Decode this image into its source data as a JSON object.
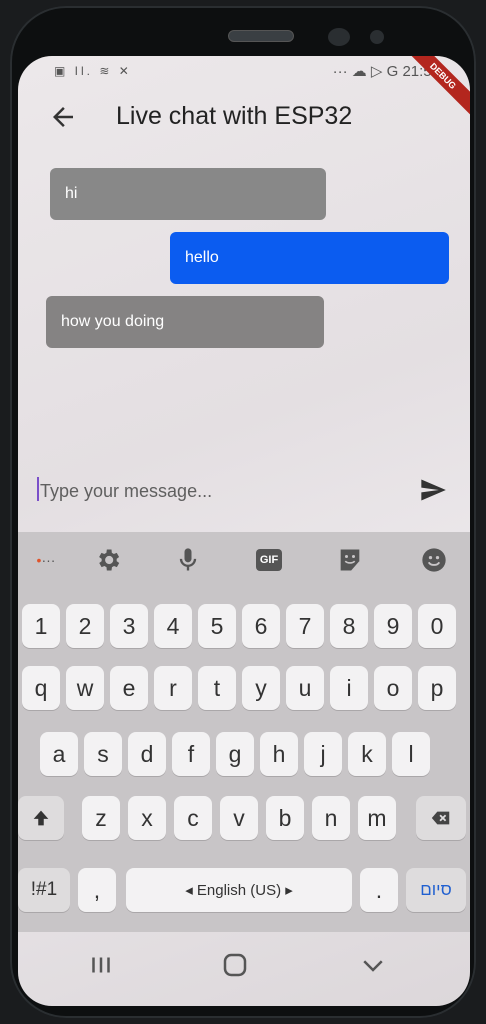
{
  "status": {
    "left_icons": "▣ Ιl. ≋ ✕",
    "right_icons": "··· ☁ ▷ G",
    "time": "21:58",
    "debug_label": "DEBUG"
  },
  "appbar": {
    "title": "Live chat with ESP32"
  },
  "messages": [
    {
      "text": "hi",
      "sender": "other"
    },
    {
      "text": "hello",
      "sender": "me"
    },
    {
      "text": "how you doing",
      "sender": "other"
    }
  ],
  "composer": {
    "placeholder": "Type your message..."
  },
  "keyboard": {
    "toolbar": [
      "settings",
      "microphone",
      "GIF",
      "sticker",
      "emoji"
    ],
    "gif_label": "GIF",
    "row_numbers": [
      "1",
      "2",
      "3",
      "4",
      "5",
      "6",
      "7",
      "8",
      "9",
      "0"
    ],
    "row_q": [
      "q",
      "w",
      "e",
      "r",
      "t",
      "y",
      "u",
      "i",
      "o",
      "p"
    ],
    "row_a": [
      "a",
      "s",
      "d",
      "f",
      "g",
      "h",
      "j",
      "k",
      "l"
    ],
    "row_z": [
      "z",
      "x",
      "c",
      "v",
      "b",
      "n",
      "m"
    ],
    "sym_label": "!#1",
    "comma": ",",
    "space_label": "◂ English (US) ▸",
    "period": ".",
    "done_label": "סיום"
  },
  "colors": {
    "sent_bubble": "#0b5cf0",
    "received_bubble": "#888888",
    "accent": "#7a4fc9"
  }
}
